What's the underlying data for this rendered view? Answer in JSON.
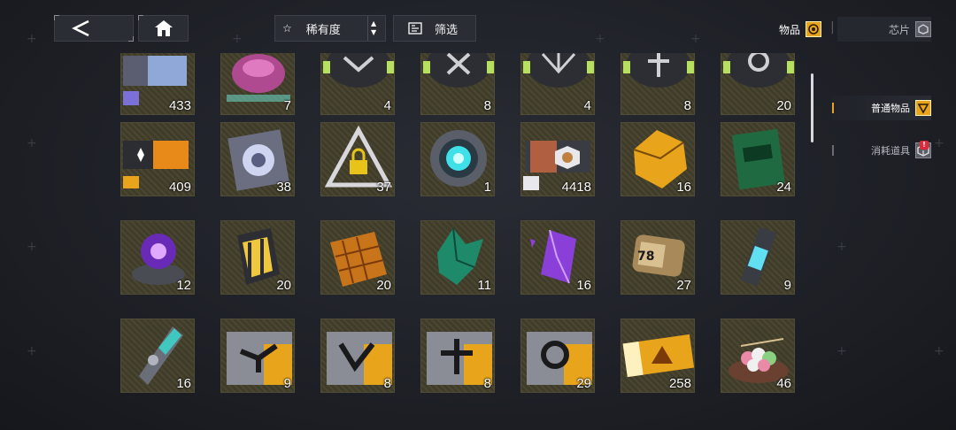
{
  "header": {
    "back_icon": "chevron-left-icon",
    "home_icon": "home-icon",
    "sort": {
      "icon": "star-outline-icon",
      "label": "稀有度",
      "toggle_icon": "sort-toggle-icon"
    },
    "filter": {
      "icon": "filter-icon",
      "label": "筛选"
    }
  },
  "top_tabs": [
    {
      "label": "物品",
      "icon": "items-tab-icon",
      "active": true
    },
    {
      "label": "芯片",
      "icon": "chip-tab-icon",
      "active": false
    }
  ],
  "side_tabs": [
    {
      "label": "普通物品",
      "icon": "general-items-icon",
      "active": true
    },
    {
      "label": "消耗道具",
      "icon": "consumables-icon",
      "active": false,
      "badge": "!"
    }
  ],
  "colors": {
    "accent": "#e8a41a",
    "badge": "#e02838",
    "tile": "#4a4631"
  },
  "items": [
    {
      "icon": "credit-ticket-icon",
      "count": "433"
    },
    {
      "icon": "gem-bag-icon",
      "count": "7"
    },
    {
      "icon": "core-module-v-icon",
      "count": "4"
    },
    {
      "icon": "core-module-x-icon",
      "count": "8"
    },
    {
      "icon": "core-module-wing-icon",
      "count": "4"
    },
    {
      "icon": "core-module-cross-icon",
      "count": "8"
    },
    {
      "icon": "core-module-gear-icon",
      "count": "20"
    },
    {
      "icon": "gold-ticket-icon",
      "count": "409"
    },
    {
      "icon": "vortex-card-icon",
      "count": "38"
    },
    {
      "icon": "locked-triangle-icon",
      "count": "37"
    },
    {
      "icon": "teal-core-icon",
      "count": "1"
    },
    {
      "icon": "badge-ticket-icon",
      "count": "4418"
    },
    {
      "icon": "gold-crystal-cluster-icon",
      "count": "16"
    },
    {
      "icon": "green-pack-icon",
      "count": "24"
    },
    {
      "icon": "purple-orb-icon",
      "count": "12"
    },
    {
      "icon": "lantern-box-icon",
      "count": "20"
    },
    {
      "icon": "gold-bricks-icon",
      "count": "20"
    },
    {
      "icon": "green-crystal-icon",
      "count": "11"
    },
    {
      "icon": "purple-crystal-icon",
      "count": "16"
    },
    {
      "icon": "battery-capsule-icon",
      "count": "27"
    },
    {
      "icon": "blue-vial-icon",
      "count": "9"
    },
    {
      "icon": "teal-drill-icon",
      "count": "16"
    },
    {
      "icon": "chip-card-bird-icon",
      "count": "9"
    },
    {
      "icon": "chip-card-v-icon",
      "count": "8"
    },
    {
      "icon": "chip-card-cross-icon",
      "count": "8"
    },
    {
      "icon": "chip-card-gear-icon",
      "count": "29"
    },
    {
      "icon": "gold-voucher-icon",
      "count": "258"
    },
    {
      "icon": "dango-plate-icon",
      "count": "46"
    }
  ]
}
